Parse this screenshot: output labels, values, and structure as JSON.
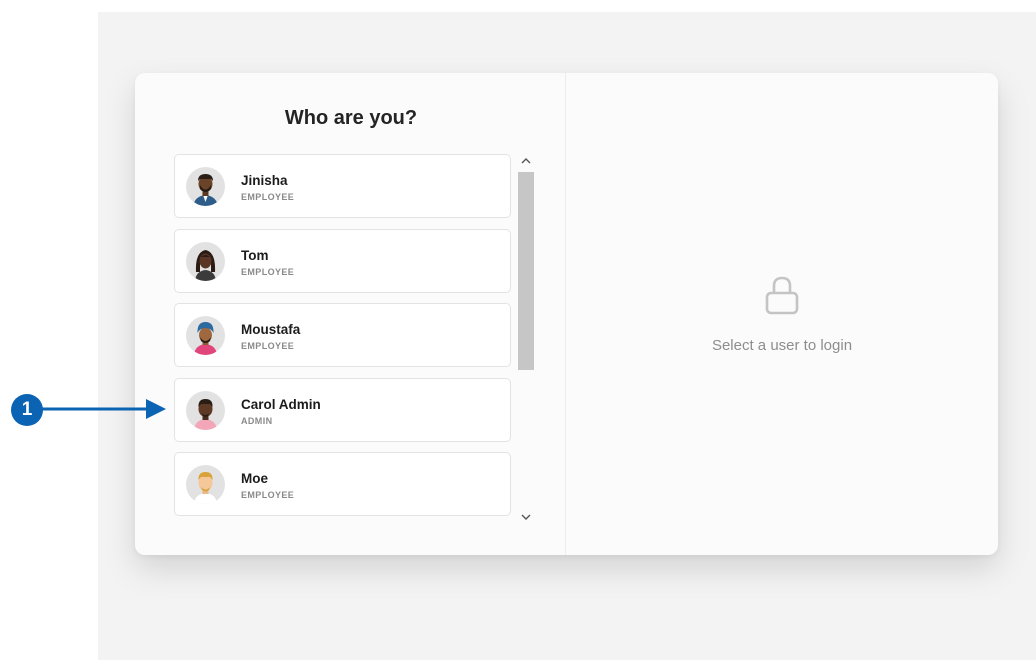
{
  "login": {
    "title": "Who are you?",
    "hint": "Select a user to login",
    "users": [
      {
        "name": "Jinisha",
        "role": "EMPLOYEE",
        "avatar": "person-avatar-icon"
      },
      {
        "name": "Tom",
        "role": "EMPLOYEE",
        "avatar": "person-avatar-icon"
      },
      {
        "name": "Moustafa",
        "role": "EMPLOYEE",
        "avatar": "person-avatar-icon"
      },
      {
        "name": "Carol Admin",
        "role": "ADMIN",
        "avatar": "person-avatar-icon"
      },
      {
        "name": "Moe",
        "role": "EMPLOYEE",
        "avatar": "person-avatar-icon"
      }
    ]
  },
  "callout": {
    "number": "1",
    "color": "#0b63b3"
  },
  "icons": {
    "lock": "lock-icon",
    "scroll_up": "chevron-up-icon",
    "scroll_down": "chevron-down-icon"
  }
}
